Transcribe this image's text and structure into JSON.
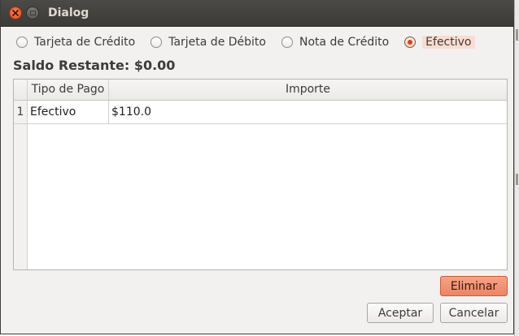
{
  "window": {
    "title": "Dialog"
  },
  "payment_types": [
    {
      "label": "Tarjeta de Crédito",
      "checked": false
    },
    {
      "label": "Tarjeta de Débito",
      "checked": false
    },
    {
      "label": "Nota de Crédito",
      "checked": false
    },
    {
      "label": "Efectivo",
      "checked": true
    }
  ],
  "saldo": {
    "text": "Saldo Restante: $0.00"
  },
  "table": {
    "columns": [
      "Tipo de Pago",
      "Importe"
    ],
    "rows": [
      {
        "num": "1",
        "tipo": "Efectivo",
        "importe": "$110.0"
      }
    ]
  },
  "buttons": {
    "eliminar": "Eliminar",
    "aceptar": "Aceptar",
    "cancelar": "Cancelar"
  },
  "colors": {
    "accent": "#ee8463",
    "titlebar": "#3c3b37",
    "window_bg": "#f2f1f0"
  }
}
